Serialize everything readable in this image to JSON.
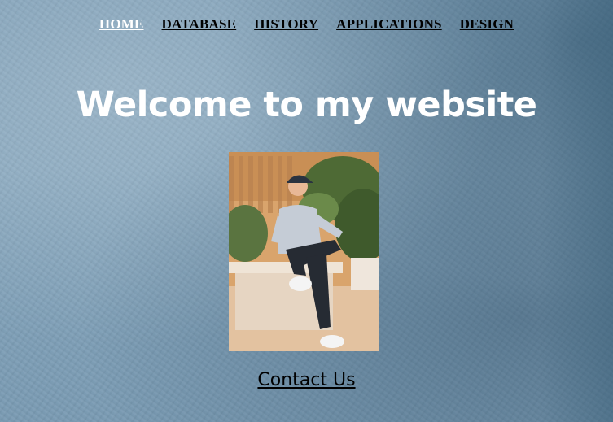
{
  "nav": {
    "items": [
      {
        "label": "HOME",
        "active": true
      },
      {
        "label": "DATABASE",
        "active": false
      },
      {
        "label": "HISTORY",
        "active": false
      },
      {
        "label": "APPLICATIONS",
        "active": false
      },
      {
        "label": "DESIGN",
        "active": false
      }
    ]
  },
  "hero": {
    "title": "Welcome to my website"
  },
  "profile_photo": {
    "subject": "man in cap sitting on stone bench outdoors"
  },
  "footer": {
    "contact_label": "Contact Us"
  },
  "colors": {
    "background": "#84a4bb",
    "active_nav": "#ffffff",
    "nav": "#000000",
    "title": "#ffffff"
  }
}
